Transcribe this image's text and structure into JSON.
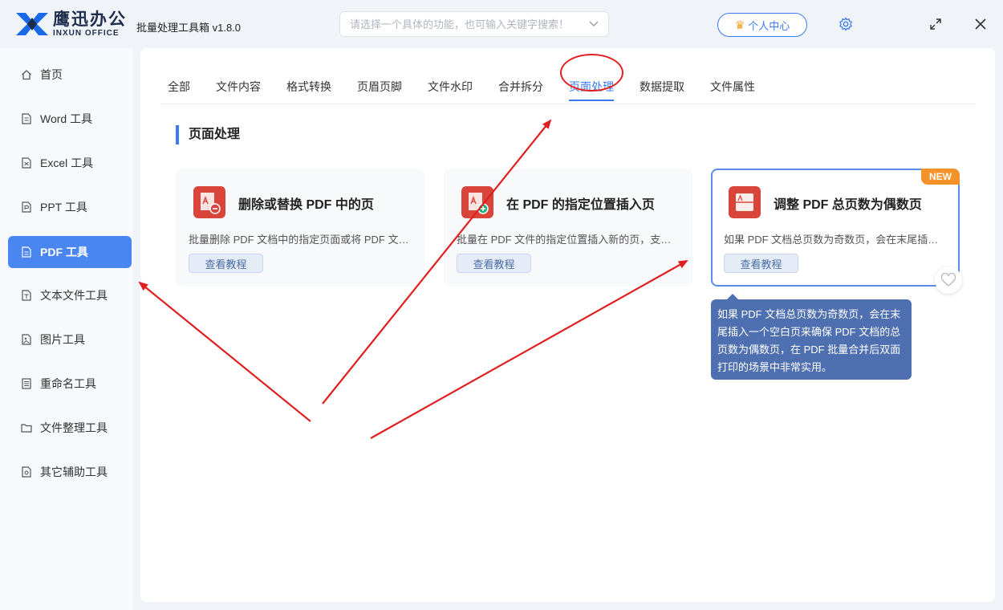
{
  "app": {
    "logo_cn": "鹰迅办公",
    "logo_en": "INXUN OFFICE",
    "title": "批量处理工具箱 v1.8.0"
  },
  "search": {
    "placeholder": "请选择一个具体的功能，也可输入关键字搜索！"
  },
  "header": {
    "user_center": "个人中心"
  },
  "sidebar": {
    "items": [
      {
        "label": "首页",
        "icon": "home-icon"
      },
      {
        "label": "Word 工具",
        "icon": "document-icon"
      },
      {
        "label": "Excel 工具",
        "icon": "document-icon"
      },
      {
        "label": "PPT 工具",
        "icon": "document-icon"
      },
      {
        "label": "PDF 工具",
        "icon": "document-icon",
        "active": true
      },
      {
        "label": "文本文件工具",
        "icon": "document-icon"
      },
      {
        "label": "图片工具",
        "icon": "image-icon"
      },
      {
        "label": "重命名工具",
        "icon": "list-icon"
      },
      {
        "label": "文件整理工具",
        "icon": "folder-icon"
      },
      {
        "label": "其它辅助工具",
        "icon": "tool-icon"
      }
    ]
  },
  "tabs": [
    {
      "label": "全部"
    },
    {
      "label": "文件内容"
    },
    {
      "label": "格式转换"
    },
    {
      "label": "页眉页脚"
    },
    {
      "label": "文件水印"
    },
    {
      "label": "合并拆分"
    },
    {
      "label": "页面处理",
      "active": true
    },
    {
      "label": "数据提取"
    },
    {
      "label": "文件属性"
    }
  ],
  "section": {
    "title": "页面处理"
  },
  "cards": [
    {
      "title": "删除或替换 PDF 中的页",
      "desc": "批量删除 PDF 文档中的指定页面或将 PDF 文档中的指定页面替换为其它内容",
      "button": "查看教程"
    },
    {
      "title": "在 PDF 的指定位置插入页",
      "desc": "批量在 PDF 文件的指定位置插入新的页，支持插入空白页或其它文档内容",
      "button": "查看教程"
    },
    {
      "title": "调整 PDF 总页数为偶数页",
      "desc": "如果 PDF 文档总页数为奇数页，会在末尾插入一个空白页来确保 PDF 文档的总页数为偶数页",
      "button": "查看教程",
      "badge": "NEW"
    }
  ],
  "tooltip": {
    "text": "如果 PDF 文档总页数为奇数页，会在末尾插入一个空白页来确保 PDF 文档的总页数为偶数页，在 PDF 批量合并后双面打印的场景中非常实用。"
  },
  "colors": {
    "accent": "#3b7bef",
    "active_sidebar": "#4a86f0",
    "pdf_red": "#d9453b",
    "badge": "#f5922a",
    "tooltip": "#4f70b0",
    "annotation": "#e02020"
  }
}
